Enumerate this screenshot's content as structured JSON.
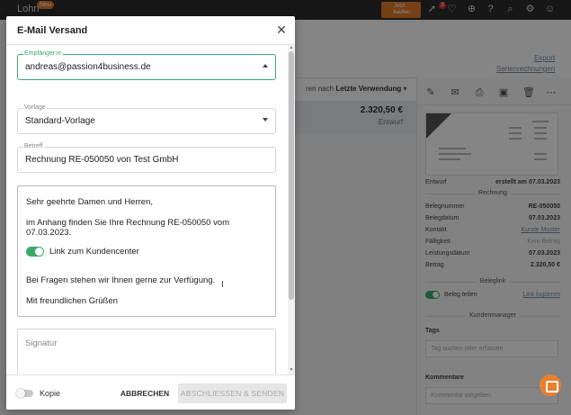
{
  "app": {
    "brand": "Lohn",
    "brand_badge": "Neu",
    "buy_button": "Jetzt kaufen",
    "notification_count": "3",
    "toolbar_icons": [
      "rocket-icon",
      "heart-icon",
      "plus-icon",
      "help-icon",
      "search-icon",
      "gear-icon",
      "user-icon"
    ]
  },
  "background": {
    "export_link": "Export",
    "serial_invoices_link": "Serienrechnungen",
    "sort_prefix": "ren nach",
    "sort_value": "Letzte Verwendung",
    "list_amount": "2.320,50 €",
    "list_status": "Entwurf",
    "status_label": "Entwurf",
    "status_value": "erstellt am 07.03.2023",
    "invoice_section": "Rechnung",
    "invoice_fields": [
      {
        "label": "Belegnummer",
        "value": "RE-050050",
        "style": "bold"
      },
      {
        "label": "Belegdatum",
        "value": "07.03.2023",
        "style": "bold"
      },
      {
        "label": "Kontakt",
        "value": "Kunde Muster",
        "style": "link"
      },
      {
        "label": "Fälligkeit",
        "value": "Kein Betrag",
        "style": "muted"
      },
      {
        "label": "Leistungsdatum",
        "value": "07.03.2023",
        "style": "bold"
      },
      {
        "label": "Betrag",
        "value": "2.320,50 €",
        "style": "bold"
      }
    ],
    "belegl_section": "Beleglink",
    "beleg_toggle_label": "Beleg teilen",
    "copy_link": "Link kopieren",
    "customer_manager_section": "Kundenmanager",
    "tags_label": "Tags",
    "tags_placeholder": "Tag suchen oder erfassen",
    "comments_label": "Kommentare",
    "comments_placeholder": "Kommentar eingeben"
  },
  "modal": {
    "title": "E-Mail Versand",
    "recipient": {
      "label": "Empfänger:in",
      "value": "andreas@passion4business.de"
    },
    "template": {
      "label": "Vorlage",
      "value": "Standard-Vorlage"
    },
    "subject": {
      "label": "Betreff",
      "value": "Rechnung RE-050050 von Test GmbH"
    },
    "message": {
      "greeting": "Sehr geehrte Damen und Herren,",
      "line1": "im Anhang finden Sie Ihre Rechnung RE-050050 vom 07.03.2023.",
      "toggle_label": "Link zum Kundencenter",
      "line2": "Bei Fragen stehen wir Ihnen gerne zur Verfügung.",
      "closing": "Mit freundlichen Grüßen"
    },
    "signature_placeholder": "Signatur",
    "copy_label": "Kopie",
    "cancel_button": "ABBRECHEN",
    "finish_button": "ABSCHLIESSEN & SENDEN"
  },
  "colors": {
    "accent": "#3aaa6a",
    "brand_orange": "#e07b2a"
  }
}
